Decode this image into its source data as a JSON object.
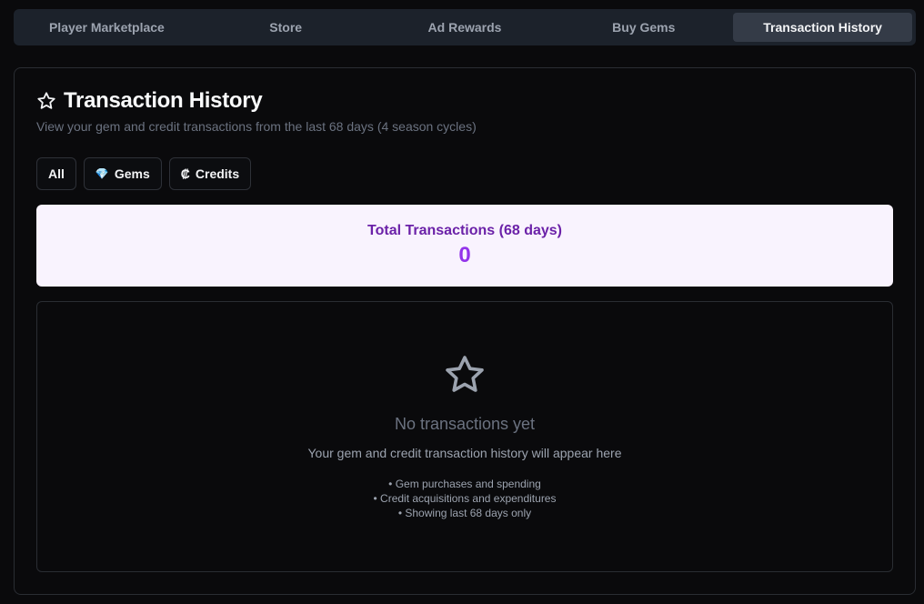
{
  "tabs": [
    {
      "label": "Player Marketplace",
      "active": false
    },
    {
      "label": "Store",
      "active": false
    },
    {
      "label": "Ad Rewards",
      "active": false
    },
    {
      "label": "Buy Gems",
      "active": false
    },
    {
      "label": "Transaction History",
      "active": true
    }
  ],
  "header": {
    "title": "Transaction History",
    "title_icon": "star-outline-icon",
    "subtitle": "View your gem and credit transactions from the last 68 days (4 season cycles)"
  },
  "filters": {
    "all_label": "All",
    "gems_icon": "💎",
    "gems_label": "Gems",
    "credits_icon": "₡",
    "credits_label": "Credits"
  },
  "summary": {
    "label": "Total Transactions (68 days)",
    "value": "0"
  },
  "empty_state": {
    "icon": "star-outline-icon",
    "title": "No transactions yet",
    "description": "Your gem and credit transaction history will appear here",
    "notes": [
      "• Gem purchases and spending",
      "• Credit acquisitions and expenditures",
      "• Showing last 68 days only"
    ]
  },
  "colors": {
    "summary_background": "#f9f3fe",
    "summary_label": "#6b21a8",
    "summary_value": "#9333ea",
    "active_tab": "#343b47"
  }
}
